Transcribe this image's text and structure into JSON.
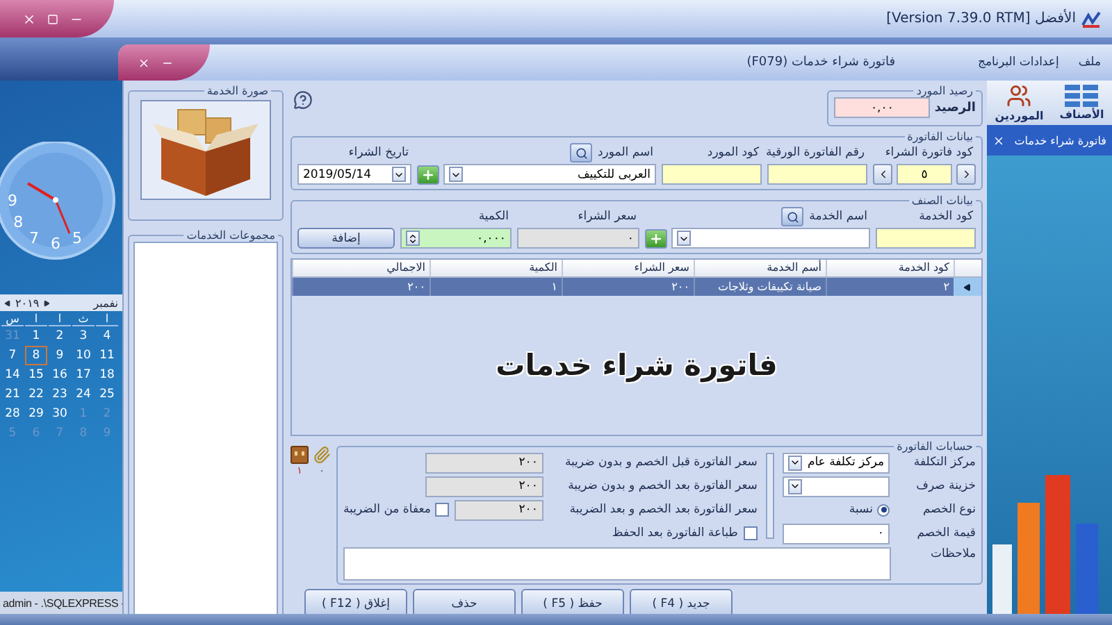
{
  "window": {
    "title": "الأفضل [Version 7.39.0 RTM]"
  },
  "menu": [
    {
      "label": "ملف"
    },
    {
      "label": "إعدادات البرنامج"
    }
  ],
  "document": {
    "title": "فاتورة شراء خدمات  (F079)"
  },
  "sidebar": {
    "shortcuts": [
      {
        "kind": "items",
        "label": "الأصناف"
      },
      {
        "kind": "suppliers",
        "label": "الموردين"
      }
    ],
    "tabs": [
      {
        "label": "فاتورة شراء خدمات",
        "selected": true
      }
    ]
  },
  "desktop": {
    "clock_numerals": [
      "9",
      "8",
      "7",
      "6",
      "5"
    ],
    "calendar": {
      "month": "نفمبر",
      "year": "٢٠١٩",
      "weekdays": [
        "ا",
        "ث",
        "ا",
        "ا",
        "س"
      ],
      "days": [
        {
          "label": "4",
          "muted": false,
          "selected": false
        },
        {
          "label": "3",
          "muted": false,
          "selected": false
        },
        {
          "label": "2",
          "muted": false,
          "selected": false
        },
        {
          "label": "1",
          "muted": false,
          "selected": false
        },
        {
          "label": "31",
          "muted": true,
          "selected": false
        },
        {
          "label": "11",
          "muted": false,
          "selected": false
        },
        {
          "label": "10",
          "muted": false,
          "selected": false
        },
        {
          "label": "9",
          "muted": false,
          "selected": false
        },
        {
          "label": "8",
          "muted": false,
          "selected": true
        },
        {
          "label": "7",
          "muted": false,
          "selected": false
        },
        {
          "label": "18",
          "muted": false,
          "selected": false
        },
        {
          "label": "17",
          "muted": false,
          "selected": false
        },
        {
          "label": "16",
          "muted": false,
          "selected": false
        },
        {
          "label": "15",
          "muted": false,
          "selected": false
        },
        {
          "label": "14",
          "muted": false,
          "selected": false
        },
        {
          "label": "25",
          "muted": false,
          "selected": false
        },
        {
          "label": "24",
          "muted": false,
          "selected": false
        },
        {
          "label": "23",
          "muted": false,
          "selected": false
        },
        {
          "label": "22",
          "muted": false,
          "selected": false
        },
        {
          "label": "21",
          "muted": false,
          "selected": false
        },
        {
          "label": "2",
          "muted": true,
          "selected": false
        },
        {
          "label": "1",
          "muted": true,
          "selected": false
        },
        {
          "label": "30",
          "muted": false,
          "selected": false
        },
        {
          "label": "29",
          "muted": false,
          "selected": false
        },
        {
          "label": "28",
          "muted": false,
          "selected": false
        },
        {
          "label": "9",
          "muted": true,
          "selected": false
        },
        {
          "label": "8",
          "muted": true,
          "selected": false
        },
        {
          "label": "7",
          "muted": true,
          "selected": false
        },
        {
          "label": "6",
          "muted": true,
          "selected": false
        },
        {
          "label": "5",
          "muted": true,
          "selected": false
        }
      ]
    },
    "status": "admin - .\\SQLEXPRESS -"
  },
  "balance": {
    "title": "رصيد المورد",
    "label": "الرصيد",
    "value": "٠,٠٠"
  },
  "invoice": {
    "title": "بيانات الفاتورة",
    "fields": [
      {
        "kind": "navigator",
        "label": "كود فاتورة الشراء",
        "value": "٥"
      },
      {
        "kind": "code",
        "label": "رقم الفاتورة الورقية"
      },
      {
        "kind": "code",
        "label": "كود المورد"
      },
      {
        "kind": "lookup",
        "label": "اسم المورد",
        "value": "العربى للتكييف"
      },
      {
        "kind": "date",
        "label": "تاريخ الشراء",
        "value": "2019/05/14"
      }
    ]
  },
  "item": {
    "title": "بيانات الصنف",
    "add_button": "إضافة",
    "fields": [
      {
        "kind": "code",
        "label": "كود الخدمة"
      },
      {
        "kind": "lookup",
        "label": "اسم الخدمة"
      },
      {
        "kind": "readonly",
        "label": "سعر الشراء",
        "value": "٠"
      },
      {
        "kind": "quantity",
        "label": "الكمية",
        "value": "٠,٠٠٠"
      }
    ]
  },
  "table": {
    "columns": [
      "كود الخدمة",
      "أسم الخدمة",
      "سعر الشراء",
      "الكمية",
      "الاجمالي"
    ],
    "rows": [
      {
        "cells": [
          "٢",
          "صيانة تكييفات وثلاجات",
          "٢٠٠",
          "١",
          "٢٠٠"
        ],
        "selected": true
      }
    ],
    "caption": "فاتورة شراء خدمات"
  },
  "accounts": {
    "title": "حسابات الفاتورة",
    "fields": [
      {
        "kind": "combo",
        "label": "مركز التكلفة",
        "value": "مركز تكلفة عام"
      },
      {
        "kind": "combo",
        "label": "خزينة صرف"
      },
      {
        "kind": "radio",
        "label": "نوع الخصم",
        "options": [
          {
            "label": "نسبة",
            "selected": true
          }
        ]
      },
      {
        "kind": "text",
        "label": "قيمة الخصم",
        "value": "٠"
      }
    ],
    "totals": [
      {
        "label": "سعر الفاتورة قبل الخصم و بدون ضريبة",
        "value": "٢٠٠"
      },
      {
        "label": "سعر الفاتورة بعد الخصم و بدون ضريبة",
        "value": "٢٠٠"
      },
      {
        "label": "سعر الفاتورة بعد الخصم و بعد الضريبة",
        "value": "٢٠٠",
        "checkbox": {
          "label": "معفاة من الضريبة",
          "checked": false
        }
      }
    ],
    "print_after_save": {
      "label": "طباعة الفاتورة بعد الحفظ",
      "checked": false
    },
    "notes": {
      "label": "ملاحظات"
    }
  },
  "side_icons": [
    {
      "kind": "paperclip",
      "count": "٠"
    },
    {
      "kind": "box",
      "count": "١"
    }
  ],
  "buttons": [
    "جديد ( F4 )",
    "حفظ ( F5 )",
    "حذف",
    "إغلاق ( F12 )"
  ],
  "service_image": {
    "title": "صورة الخدمة"
  },
  "service_groups": {
    "title": "مجموعات الخدمات"
  }
}
